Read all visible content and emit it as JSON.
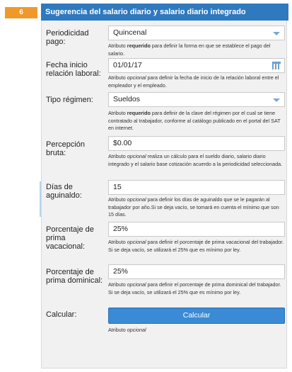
{
  "step": {
    "number": "6"
  },
  "header": {
    "title": "Sugerencia del salario diario y salario diario integrado"
  },
  "fields": {
    "periodicidad": {
      "label": "Periodicidad pago:",
      "value": "Quincenal",
      "help_prefix": "Atributo ",
      "help_emphasis": "requerido",
      "help_rest": " para definir la forma en que se establece el pago del salario."
    },
    "fecha_inicio": {
      "label": "Fecha inicio relación laboral:",
      "value": "01/01/17",
      "help_prefix": "Atributo ",
      "help_emphasis": "opcional",
      "help_rest": " para definir la fecha de inicio de la relación laboral entre el empleador y el empleado."
    },
    "tipo_regimen": {
      "label": "Tipo régimen:",
      "value": "Sueldos",
      "help_prefix": "Atributo ",
      "help_emphasis": "requerido",
      "help_rest": " para definir de la clave del régimen por el cual se tiene contratado al trabajador, conforme al catálogo publicado en el portal del SAT en internet."
    },
    "percepcion_bruta": {
      "label": "Percepción bruta:",
      "value": "$0.00",
      "help_prefix": "Atributo ",
      "help_emphasis": "opcional",
      "help_rest": " realiza un cálculo para el sueldo diario, salario diario integrado y el salario base cotización acuerdo a la periodicidad seleccionada."
    },
    "dias_aguinaldo": {
      "label": "Días de aguinaldo:",
      "value": "15",
      "help_prefix": "Atributo ",
      "help_emphasis": "opcional",
      "help_rest": " para definir los días de aguinaldo que se le pagarán al trabajador por año.Si se deja vacío, se tomará en cuenta el mínimo que son 15 días."
    },
    "prima_vacacional": {
      "label": "Porcentaje de prima vacacional:",
      "value": "25%",
      "help_prefix": "Atributo ",
      "help_emphasis": "opcional",
      "help_rest": " para definir el porcentaje de prima vacacional del trabajador. Si se deja vacío, se utilizará el 25% que es mínimo por ley."
    },
    "prima_dominical": {
      "label": "Porcentaje de prima dominical:",
      "value": "25%",
      "help_prefix": "Atributo ",
      "help_emphasis": "opcional",
      "help_rest": " para definir el porcentaje de prima dominical del trabajador. Si se deja vacío, se utilizará el 25% que es mínimo por ley."
    },
    "calcular": {
      "label": "Calcular:",
      "button_label": "Calcular",
      "help_prefix": "Atributo ",
      "help_emphasis": "opcional",
      "help_rest": ""
    }
  },
  "icons": {
    "dropdown": "chevron-down-icon",
    "calendar": "calendar-icon"
  },
  "colors": {
    "header": "#2f79bf",
    "badge": "#f0992b",
    "button": "#3b8ad6",
    "panel": "#f1f1f1"
  }
}
